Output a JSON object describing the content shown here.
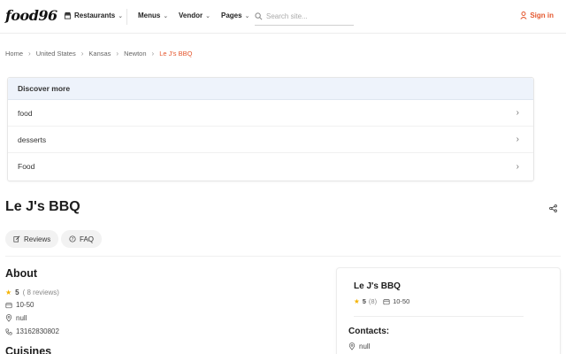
{
  "header": {
    "logo": "food96",
    "nav": [
      {
        "label": "Restaurants",
        "icon": "store-icon"
      },
      {
        "label": "Menus"
      },
      {
        "label": "Vendor"
      },
      {
        "label": "Pages"
      }
    ],
    "search_placeholder": "Search site...",
    "signin_label": "Sign in"
  },
  "breadcrumb": [
    "Home",
    "United States",
    "Kansas",
    "Newton",
    "Le J's BBQ"
  ],
  "discover": {
    "title": "Discover more",
    "items": [
      "food",
      "desserts",
      "Food"
    ]
  },
  "restaurant": {
    "name": "Le J's BBQ",
    "tabs": [
      {
        "label": "Reviews",
        "icon": "edit-icon"
      },
      {
        "label": "FAQ",
        "icon": "question-icon"
      }
    ]
  },
  "about": {
    "title": "About",
    "rating": "5",
    "reviews": "( 8 reviews)",
    "price": "10-50",
    "address": "null",
    "phone": "13162830802",
    "cuisines_title": "Cuisines"
  },
  "side_card": {
    "name": "Le J's BBQ",
    "rating": "5",
    "reviews": "(8)",
    "price": "10-50",
    "contacts_title": "Contacts:",
    "address": "null"
  },
  "colors": {
    "accent": "#e4572e",
    "star": "#f5b301",
    "discover_header_bg": "#eef3fb"
  }
}
